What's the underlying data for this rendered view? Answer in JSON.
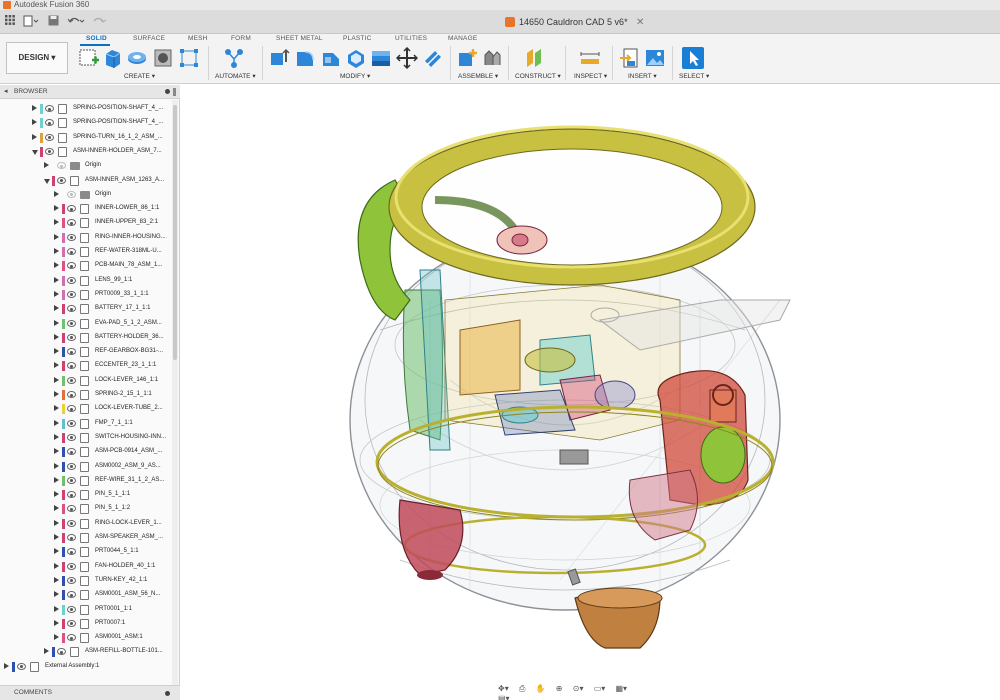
{
  "app": {
    "window_title": "Autodesk Fusion 360",
    "document_title": "14650 Cauldron CAD 5 v6*",
    "workspace": "DESIGN"
  },
  "toolbar": {
    "tabs": [
      "SOLID",
      "SURFACE",
      "MESH",
      "FORM",
      "SHEET METAL",
      "PLASTIC",
      "UTILITIES",
      "MANAGE"
    ],
    "active_tab": "SOLID",
    "groups": [
      "CREATE",
      "AUTOMATE",
      "MODIFY",
      "ASSEMBLE",
      "CONSTRUCT",
      "INSPECT",
      "INSERT",
      "SELECT"
    ]
  },
  "browser": {
    "title": "BROWSER",
    "footer": "COMMENTS",
    "items": [
      {
        "label": "SPRING-POSITION-SHAFT_4_...",
        "color": "#6fd0d0"
      },
      {
        "label": "SPRING-POSITION-SHAFT_4_...",
        "color": "#6fd0d0"
      },
      {
        "label": "SPRING-TURN_16_1_2_ASM_...",
        "color": "#e0a040"
      },
      {
        "label": "ASM-INNER-HOLDER_ASM_7...",
        "color": "#d04070"
      },
      {
        "label": "Origin",
        "color": ""
      },
      {
        "label": "ASM-INNER_ASM_1263_A...",
        "color": "#d04070"
      },
      {
        "label": "Origin",
        "color": ""
      },
      {
        "label": "INNER-LOWER_86_1:1",
        "color": "#d04070"
      },
      {
        "label": "INNER-UPPER_83_2:1",
        "color": "#e05080"
      },
      {
        "label": "RING-INNER-HOUSING...",
        "color": "#d070b0"
      },
      {
        "label": "REF-WATER-318ML-U...",
        "color": "#d070b0"
      },
      {
        "label": "PCB-MAIN_78_ASM_1...",
        "color": "#e05080"
      },
      {
        "label": "LENS_99_1:1",
        "color": "#d070b0"
      },
      {
        "label": "PRT0009_33_1_1:1",
        "color": "#d070b0"
      },
      {
        "label": "BATTERY_17_1_1:1",
        "color": "#d04070"
      },
      {
        "label": "EVA-PAD_5_1_2_ASM...",
        "color": "#70c070"
      },
      {
        "label": "BATTERY-HOLDER_36...",
        "color": "#d04070"
      },
      {
        "label": "REF-GEARBOX-BG31-...",
        "color": "#3050b0"
      },
      {
        "label": "ECCENTER_23_1_1:1",
        "color": "#d04070"
      },
      {
        "label": "LOCK-LEVER_146_1:1",
        "color": "#70c070"
      },
      {
        "label": "SPRING-2_15_1_1:1",
        "color": "#e07040"
      },
      {
        "label": "LOCK-LEVER-TUBE_2...",
        "color": "#e8d040"
      },
      {
        "label": "FMP_7_1_1:1",
        "color": "#60c0d0"
      },
      {
        "label": "SWITCH-HOUSING-INN...",
        "color": "#d04070"
      },
      {
        "label": "ASM-PCB-0914_ASM_...",
        "color": "#3050b0"
      },
      {
        "label": "ASM0002_ASM_9_AS...",
        "color": "#3050b0"
      },
      {
        "label": "REF-WIRE_31_1_2_AS...",
        "color": "#70c070"
      },
      {
        "label": "PIN_5_1_1:1",
        "color": "#d04070"
      },
      {
        "label": "PIN_5_1_1:2",
        "color": "#e05080"
      },
      {
        "label": "RING-LOCK-LEVER_1...",
        "color": "#d04070"
      },
      {
        "label": "ASM-SPEAKER_ASM_...",
        "color": "#d04070"
      },
      {
        "label": "PRT0044_5_1:1",
        "color": "#3050b0"
      },
      {
        "label": "FAN-HOLDER_40_1:1",
        "color": "#d04070"
      },
      {
        "label": "TURN-KEY_42_1:1",
        "color": "#3050b0"
      },
      {
        "label": "ASM0001_ASM_56_N...",
        "color": "#3050b0"
      },
      {
        "label": "PRT0001_1:1",
        "color": "#6fd0d0"
      },
      {
        "label": "PRT0007:1",
        "color": "#d04070"
      },
      {
        "label": "ASM0001_ASM:1",
        "color": "#e05080"
      },
      {
        "label": "ASM-REFILL-BOTTLE-101...",
        "color": "#3050b0"
      },
      {
        "label": "External Assembly:1",
        "color": "#3050b0"
      }
    ]
  },
  "colors": {
    "accent": "#0a6fc2",
    "model_ring": "#c8c040"
  }
}
